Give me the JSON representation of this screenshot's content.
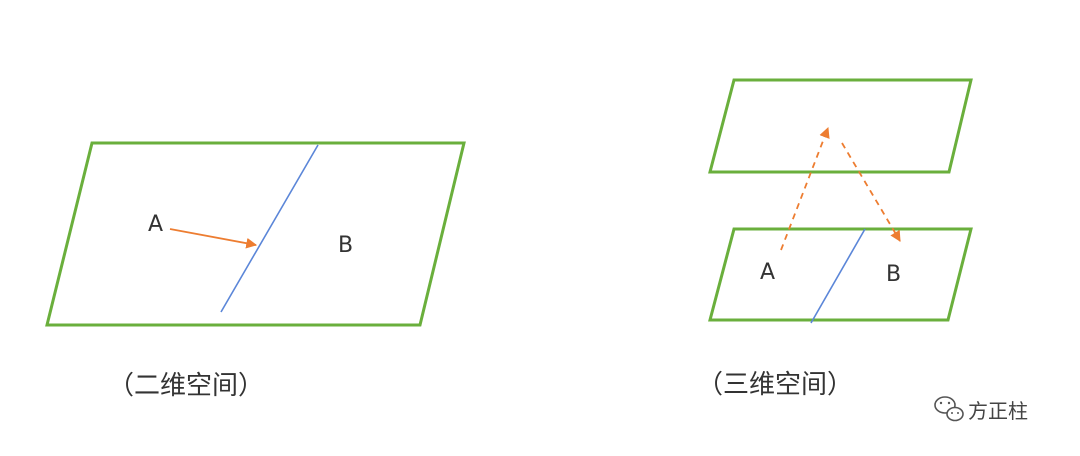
{
  "colors": {
    "plane_stroke": "#6aaf3c",
    "divider": "#5b86d8",
    "arrow": "#ed7d31",
    "text": "#333333",
    "background": "#ffffff"
  },
  "left_diagram": {
    "label_a": "A",
    "label_b": "B",
    "caption": "（二维空间）"
  },
  "right_diagram": {
    "label_a": "A",
    "label_b": "B",
    "caption": "（三维空间）"
  },
  "watermark": {
    "icon": "wechat-icon",
    "text": "方正柱"
  }
}
